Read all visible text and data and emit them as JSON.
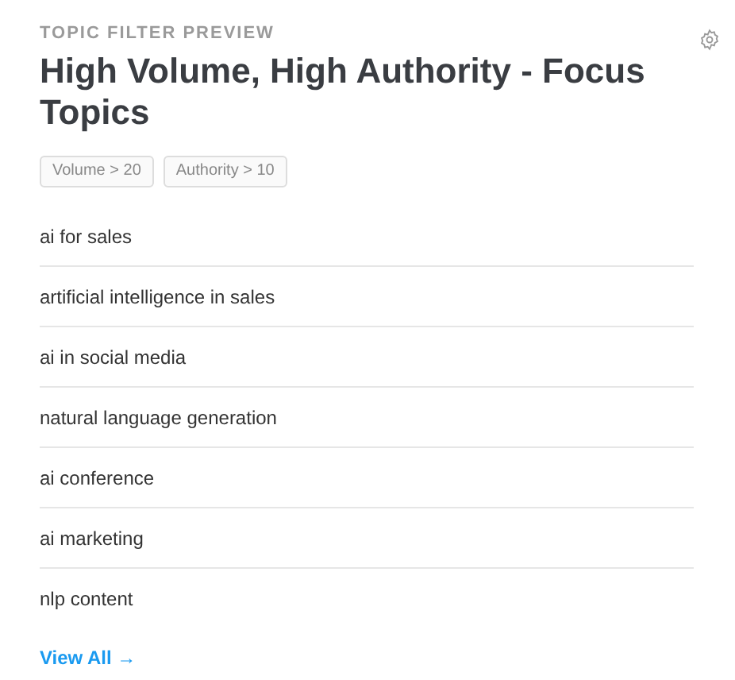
{
  "overline": "TOPIC FILTER PREVIEW",
  "title": "High Volume, High Authority - Focus Topics",
  "filters": [
    "Volume > 20",
    "Authority > 10"
  ],
  "topics": [
    "ai for sales",
    "artificial intelligence in sales",
    "ai in social media",
    "natural language generation",
    "ai conference",
    "ai marketing",
    "nlp content"
  ],
  "view_all": "View All →"
}
